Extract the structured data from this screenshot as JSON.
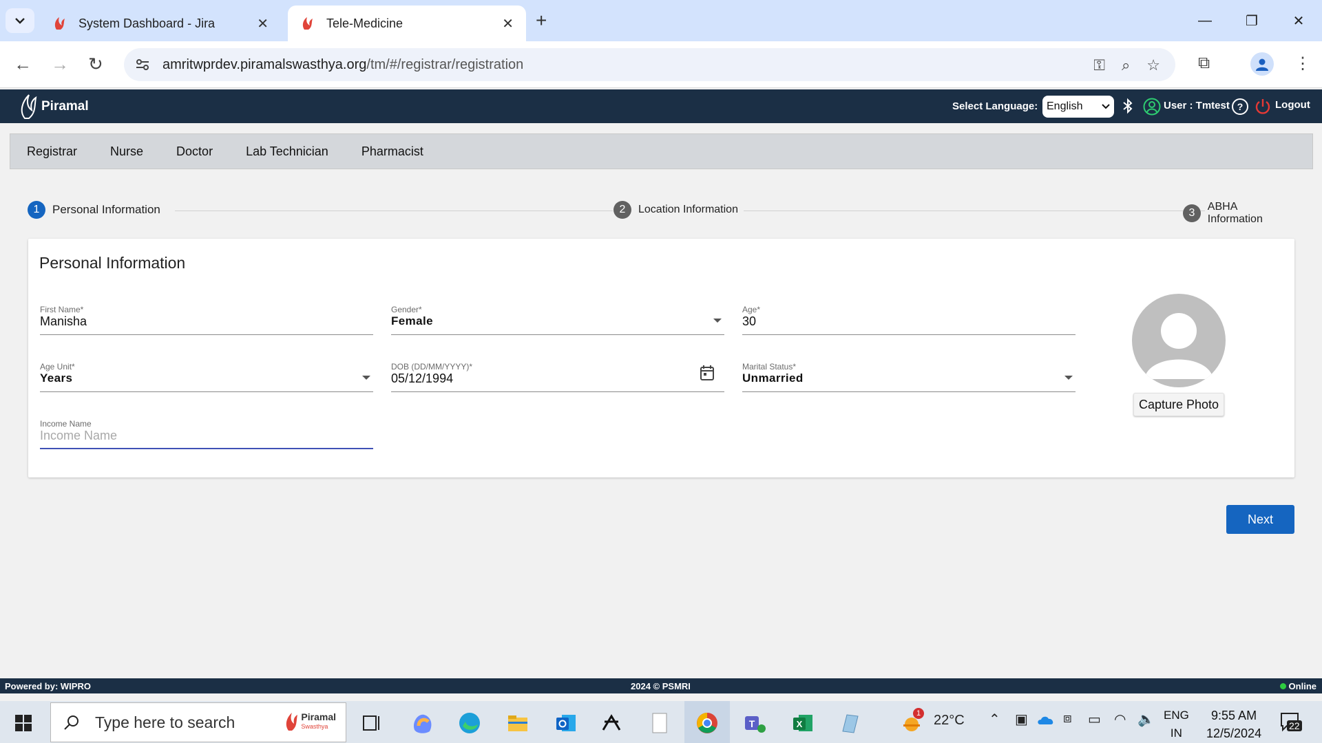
{
  "browser": {
    "tabs": [
      {
        "title": "System Dashboard - Jira",
        "active": false
      },
      {
        "title": "Tele-Medicine",
        "active": true
      }
    ],
    "url_domain": "amritwprdev.piramalswasthya.org",
    "url_path": "/tm/#/registrar/registration"
  },
  "header": {
    "logo_text": "Piramal",
    "language_label": "Select Language:",
    "language_value": "English",
    "user_text": "User :  Tmtest",
    "logout_label": "Logout"
  },
  "menu": {
    "items": [
      "Registrar",
      "Nurse",
      "Doctor",
      "Lab Technician",
      "Pharmacist"
    ]
  },
  "stepper": {
    "steps": [
      {
        "num": "1",
        "label": "Personal Information",
        "active": true
      },
      {
        "num": "2",
        "label": "Location Information",
        "active": false
      },
      {
        "num": "3",
        "label": "ABHA Information",
        "active": false
      }
    ]
  },
  "form": {
    "title": "Personal Information",
    "first_name": {
      "label": "First Name*",
      "value": "Manisha"
    },
    "gender": {
      "label": "Gender*",
      "value": "Female"
    },
    "age": {
      "label": "Age*",
      "value": "30"
    },
    "age_unit": {
      "label": "Age Unit*",
      "value": "Years"
    },
    "dob": {
      "label": "DOB (DD/MM/YYYY)*",
      "value": "05/12/1994"
    },
    "marital_status": {
      "label": "Marital Status*",
      "value": "Unmarried"
    },
    "income": {
      "label": "Income Name",
      "placeholder": "Income Name",
      "value": ""
    },
    "capture_photo_label": "Capture Photo",
    "next_label": "Next"
  },
  "footer": {
    "powered_by": "Powered by: WIPRO",
    "copyright": "2024 © PSMRI",
    "status": "Online"
  },
  "taskbar": {
    "search_placeholder": "Type here to search",
    "search_brand": "Piramal",
    "search_brand_sub": "Swasthya",
    "weather": "22°C",
    "weather_badge": "1",
    "lang_line1": "ENG",
    "lang_line2": "IN",
    "time": "9:55 AM",
    "date": "12/5/2024",
    "notifications": "22"
  },
  "colors": {
    "app_header": "#1b2f45",
    "primary": "#1565c0",
    "tab_strip": "#d3e3fd"
  }
}
